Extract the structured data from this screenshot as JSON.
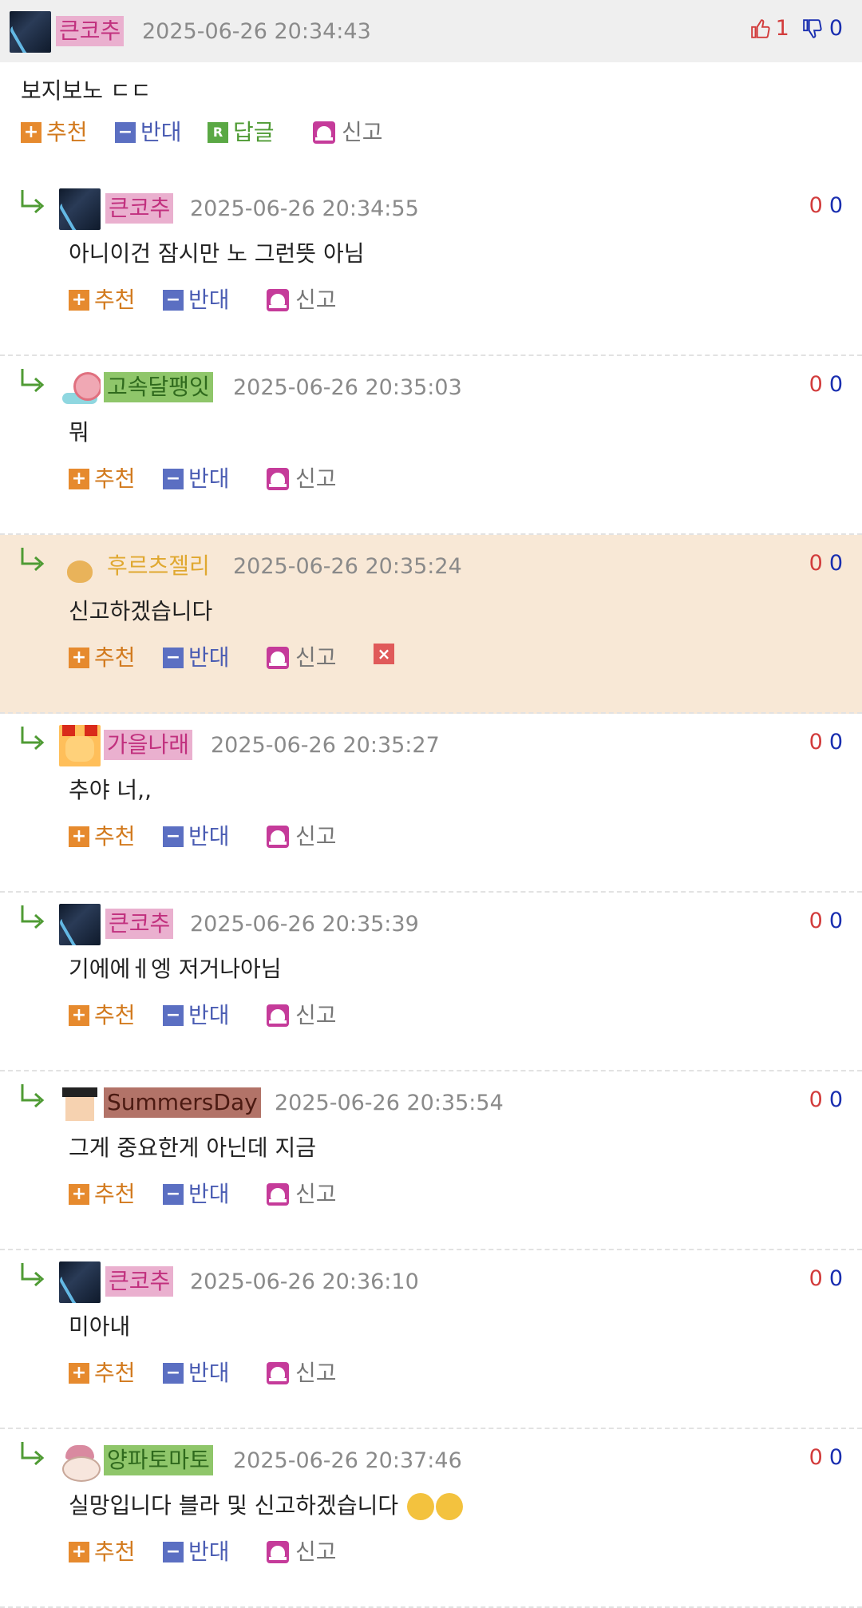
{
  "labels": {
    "recommend": "추천",
    "oppose": "반대",
    "reply": "답글",
    "report": "신고"
  },
  "top": {
    "nick": "큰코추",
    "time": "2025-06-26 20:34:43",
    "up": "1",
    "down": "0",
    "text": "보지보노 ㄷㄷ"
  },
  "replies": [
    {
      "nick": "큰코추",
      "time": "2025-06-26 20:34:55",
      "up": "0",
      "down": "0",
      "text": "아니이건 잠시만 노 그런뜻 아님"
    },
    {
      "nick": "고속달팽잇",
      "time": "2025-06-26 20:35:03",
      "up": "0",
      "down": "0",
      "text": "뭐"
    },
    {
      "nick": "후르츠젤리",
      "time": "2025-06-26 20:35:24",
      "up": "0",
      "down": "0",
      "text": "신고하겠습니다"
    },
    {
      "nick": "가을나래",
      "time": "2025-06-26 20:35:27",
      "up": "0",
      "down": "0",
      "text": "추야 너,,"
    },
    {
      "nick": "큰코추",
      "time": "2025-06-26 20:35:39",
      "up": "0",
      "down": "0",
      "text": "기에에ㅔ엥 저거나아님"
    },
    {
      "nick": "SummersDay",
      "time": "2025-06-26 20:35:54",
      "up": "0",
      "down": "0",
      "text": "그게 중요한게 아닌데 지금"
    },
    {
      "nick": "큰코추",
      "time": "2025-06-26 20:36:10",
      "up": "0",
      "down": "0",
      "text": "미아내"
    },
    {
      "nick": "양파토마토",
      "time": "2025-06-26 20:37:46",
      "up": "0",
      "down": "0",
      "text": "실망입니다 블라 및 신고하겠습니다"
    }
  ],
  "colors": {
    "recommend": "#e68a2e",
    "oppose": "#5b6fc2",
    "reply": "#5aa844",
    "report": "#c53b9a",
    "highlight": "#f8e8d6"
  }
}
